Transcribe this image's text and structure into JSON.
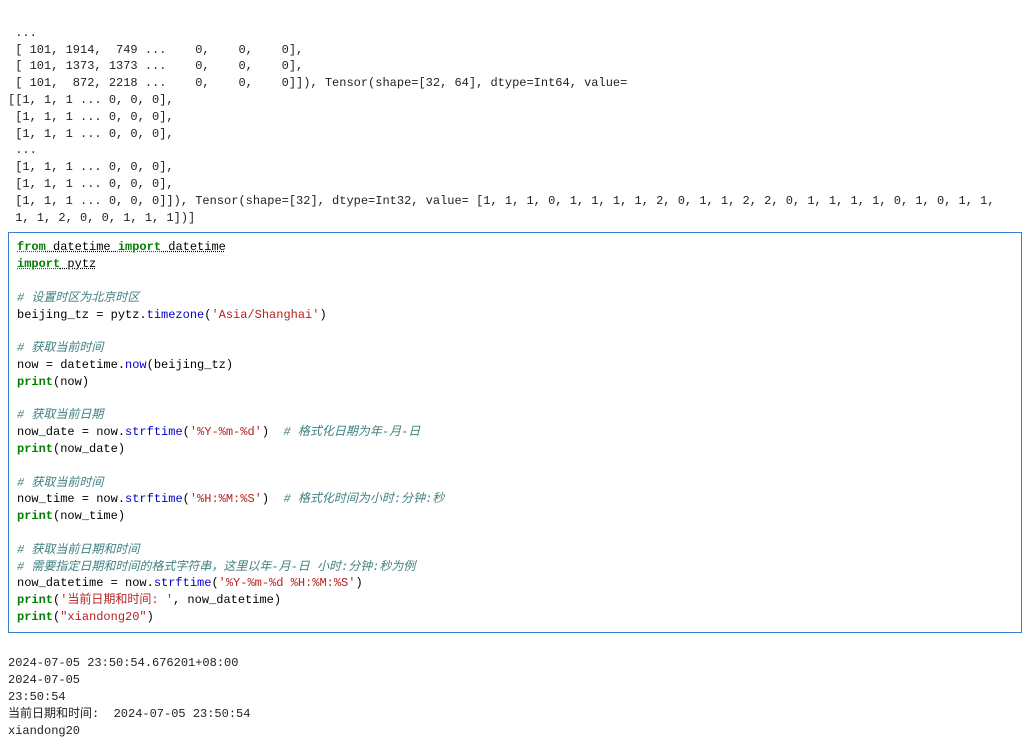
{
  "output_top": [
    " ...",
    " [ 101, 1914,  749 ...    0,    0,    0],",
    " [ 101, 1373, 1373 ...    0,    0,    0],",
    " [ 101,  872, 2218 ...    0,    0,    0]]), Tensor(shape=[32, 64], dtype=Int64, value=",
    "[[1, 1, 1 ... 0, 0, 0],",
    " [1, 1, 1 ... 0, 0, 0],",
    " [1, 1, 1 ... 0, 0, 0],",
    " ...",
    " [1, 1, 1 ... 0, 0, 0],",
    " [1, 1, 1 ... 0, 0, 0],",
    " [1, 1, 1 ... 0, 0, 0]]), Tensor(shape=[32], dtype=Int32, value= [1, 1, 1, 0, 1, 1, 1, 1, 2, 0, 1, 1, 2, 2, 0, 1, 1, 1, 1, 0, 1, 0, 1, 1,",
    " 1, 1, 2, 0, 0, 1, 1, 1])]"
  ],
  "code": {
    "kw_from": "from",
    "mod_datetime": " datetime ",
    "kw_import": "import",
    "name_datetime": " datetime",
    "imp_pytz": " pytz",
    "cmt1": "# 设置时区为北京时区",
    "l_beijing": "beijing_tz = pytz.",
    "fn_timezone": "timezone",
    "asia": "'Asia/Shanghai'",
    "cmt2": "# 获取当前时间",
    "l_now_pre": "now = datetime.",
    "fn_now": "now",
    "l_now_post": "(beijing_tz)",
    "l_print_now_a": "(now)",
    "cmt3": "# 获取当前日期",
    "l_nowdate_pre": "now_date = now.",
    "fn_strftime": "strftime",
    "fmt_date": "'%Y-%m-%d'",
    "cmt_date_inline": "# 格式化日期为年-月-日",
    "l_print_nowdate": "(now_date)",
    "cmt4": "# 获取当前时间",
    "l_nowtime_pre": "now_time = now.",
    "fmt_time": "'%H:%M:%S'",
    "cmt_time_inline": "# 格式化时间为小时:分钟:秒",
    "l_print_nowtime": "(now_time)",
    "cmt5": "# 获取当前日期和时间",
    "cmt6": "# 需要指定日期和时间的格式字符串，这里以年-月-日 小时:分钟:秒为例",
    "l_nowdt_pre": "now_datetime = now.",
    "fmt_dt": "'%Y-%m-%d %H:%M:%S'",
    "label_str": "'当前日期和时间: '",
    "l_print_end": ", now_datetime)",
    "str_xd": "\"xiandong20\"",
    "fn_print": "print"
  },
  "output_bottom": [
    "2024-07-05 23:50:54.676201+08:00",
    "2024-07-05",
    "23:50:54",
    "当前日期和时间:  2024-07-05 23:50:54",
    "xiandong20"
  ]
}
